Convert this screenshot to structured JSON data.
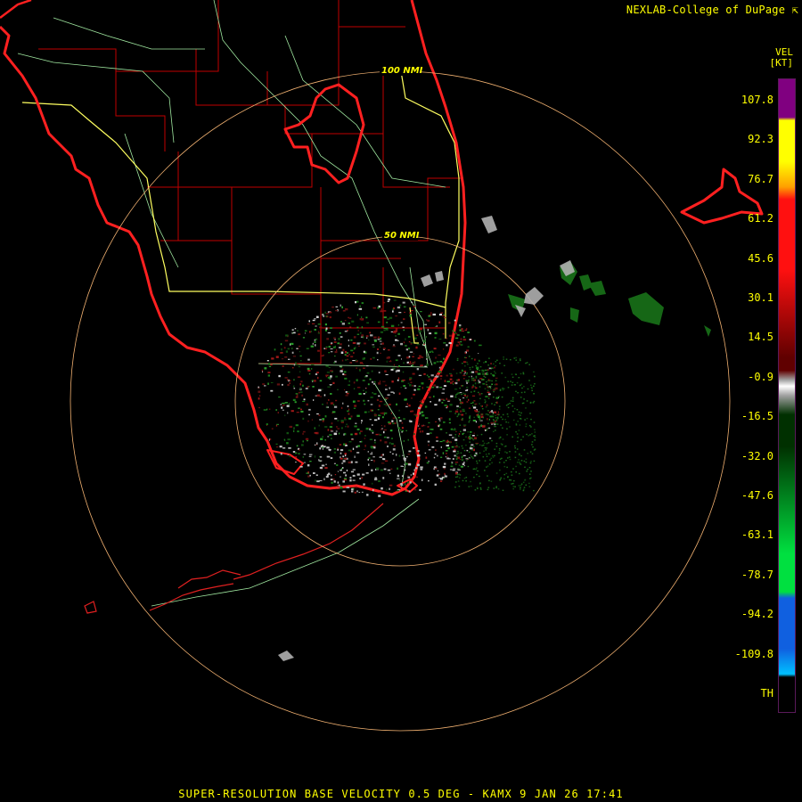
{
  "header": {
    "credit": "NEXLAB-College of DuPage",
    "credit_icon": "external-link-icon"
  },
  "legend": {
    "product": "VEL",
    "units": "[KT]",
    "labels": [
      "107.8",
      "92.3",
      "76.7",
      "61.2",
      "45.6",
      "30.1",
      "14.5",
      "-0.9",
      "-16.5",
      "-32.0",
      "-47.6",
      "-63.1",
      "-78.7",
      "-94.2",
      "-109.8",
      "TH"
    ],
    "colors": {
      "purple": "#800080",
      "yellow": "#ffff00",
      "orange": "#ffa000",
      "red": "#ff1010",
      "dark_red": "#600000",
      "gray": "#a0a0a0",
      "dark_green": "#003000",
      "green": "#00e040",
      "blue": "#1060e0",
      "cyan": "#00c0ff",
      "range_folded": "#000000"
    }
  },
  "range_rings": [
    "100 NMI",
    "50 NMI"
  ],
  "colors": {
    "coastline": "#ff2020",
    "county": "#c00000",
    "highway": "#a0e8a0",
    "interstate": "#ffff60",
    "ring": "#f0b070"
  },
  "footer": {
    "caption": "SUPER-RESOLUTION BASE VELOCITY 0.5 DEG - KAMX 9 JAN 26 17:41"
  }
}
